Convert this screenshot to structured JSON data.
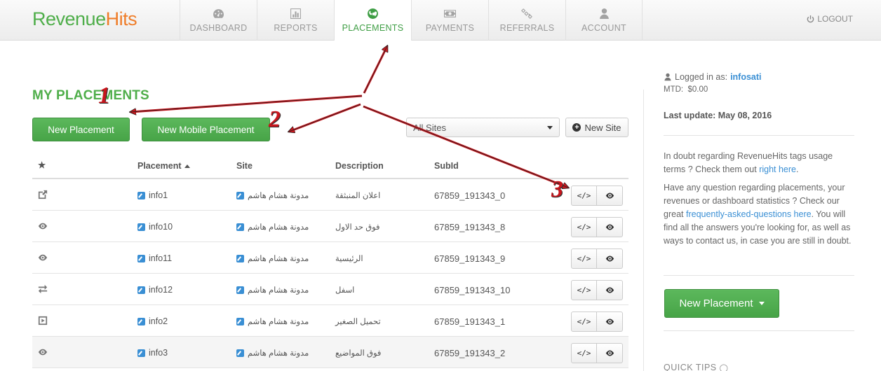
{
  "brand": {
    "part1": "Revenue",
    "part2": "Hits"
  },
  "nav": {
    "items": [
      {
        "label": "DASHBOARD",
        "icon": "dashboard-icon"
      },
      {
        "label": "REPORTS",
        "icon": "bar-chart-icon"
      },
      {
        "label": "PLACEMENTS",
        "icon": "globe-icon",
        "active": true
      },
      {
        "label": "PAYMENTS",
        "icon": "money-icon"
      },
      {
        "label": "REFERRALS",
        "icon": "link-icon"
      },
      {
        "label": "ACCOUNT",
        "icon": "user-icon"
      }
    ],
    "logout_label": "LOGOUT"
  },
  "main": {
    "title": "MY PLACEMENTS",
    "new_placement_label": "New Placement",
    "new_mobile_label": "New Mobile Placement",
    "site_select_value": "All Sites",
    "new_site_label": "New Site",
    "columns": {
      "star": "★",
      "placement": "Placement",
      "site": "Site",
      "description": "Description",
      "subid": "SubId"
    },
    "rows": [
      {
        "type_icon": "external-link-icon",
        "placement": "info1",
        "site": "مدونة هشام هاشم",
        "description": "اعلان المنبثقة",
        "subid": "67859_191343_0"
      },
      {
        "type_icon": "eye-icon",
        "placement": "info10",
        "site": "مدونة هشام هاشم",
        "description": "فوق حد الاول",
        "subid": "67859_191343_8"
      },
      {
        "type_icon": "eye-icon",
        "placement": "info11",
        "site": "مدونة هشام هاشم",
        "description": "الرئيسية",
        "subid": "67859_191343_9"
      },
      {
        "type_icon": "exchange-icon",
        "placement": "info12",
        "site": "مدونة هشام هاشم",
        "description": "اسفل",
        "subid": "67859_191343_10"
      },
      {
        "type_icon": "play-icon",
        "placement": "info2",
        "site": "مدونة هشام هاشم",
        "description": "تحميل الصغير",
        "subid": "67859_191343_1"
      },
      {
        "type_icon": "eye-icon",
        "placement": "info3",
        "site": "مدونة هشام هاشم",
        "description": "فوق المواضيع",
        "subid": "67859_191343_2"
      }
    ],
    "code_button_label": "</>"
  },
  "sidebar": {
    "logged_prefix": "Logged in as:",
    "username": "infosati",
    "mtd_label": "MTD:",
    "mtd_value": "$0.00",
    "last_update": "Last update: May 08, 2016",
    "doubt_text": "In doubt regarding RevenueHits tags usage terms ? Check them out",
    "doubt_link": "right here",
    "question_text": "Have any question regarding placements, your revenues or dashboard statistics ? Check our great",
    "question_link": "frequently-asked-questions here",
    "question_tail": ". You will find all the answers you're looking for, as well as ways to contact us, in case you are still in doubt.",
    "new_placement_label": "New Placement",
    "quick_tips": "QUICK TIPS"
  },
  "annotations": {
    "n1": "1",
    "n2": "2",
    "n3": "3"
  },
  "colors": {
    "brand_green": "#4fae4a",
    "brand_orange": "#ef7d29",
    "link_blue": "#3a8fd4",
    "arrow_red": "#c8161d"
  }
}
